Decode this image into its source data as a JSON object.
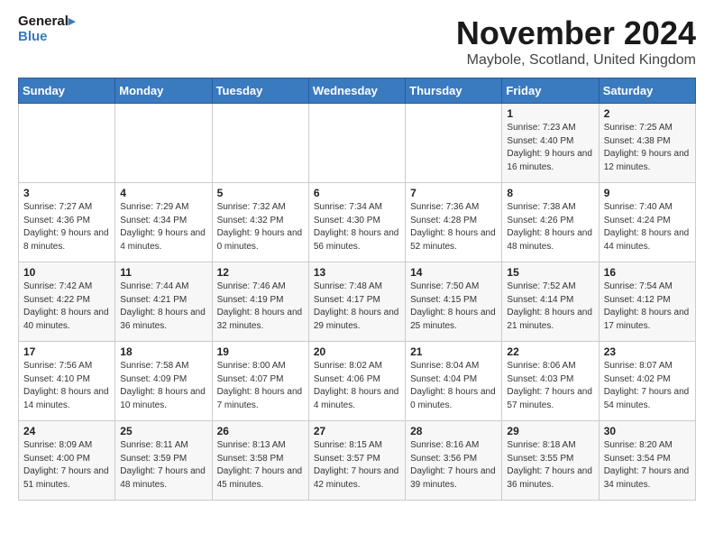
{
  "logo": {
    "line1": "General",
    "line2": "Blue"
  },
  "title": "November 2024",
  "location": "Maybole, Scotland, United Kingdom",
  "days_of_week": [
    "Sunday",
    "Monday",
    "Tuesday",
    "Wednesday",
    "Thursday",
    "Friday",
    "Saturday"
  ],
  "weeks": [
    [
      {
        "day": "",
        "info": ""
      },
      {
        "day": "",
        "info": ""
      },
      {
        "day": "",
        "info": ""
      },
      {
        "day": "",
        "info": ""
      },
      {
        "day": "",
        "info": ""
      },
      {
        "day": "1",
        "info": "Sunrise: 7:23 AM\nSunset: 4:40 PM\nDaylight: 9 hours and 16 minutes."
      },
      {
        "day": "2",
        "info": "Sunrise: 7:25 AM\nSunset: 4:38 PM\nDaylight: 9 hours and 12 minutes."
      }
    ],
    [
      {
        "day": "3",
        "info": "Sunrise: 7:27 AM\nSunset: 4:36 PM\nDaylight: 9 hours and 8 minutes."
      },
      {
        "day": "4",
        "info": "Sunrise: 7:29 AM\nSunset: 4:34 PM\nDaylight: 9 hours and 4 minutes."
      },
      {
        "day": "5",
        "info": "Sunrise: 7:32 AM\nSunset: 4:32 PM\nDaylight: 9 hours and 0 minutes."
      },
      {
        "day": "6",
        "info": "Sunrise: 7:34 AM\nSunset: 4:30 PM\nDaylight: 8 hours and 56 minutes."
      },
      {
        "day": "7",
        "info": "Sunrise: 7:36 AM\nSunset: 4:28 PM\nDaylight: 8 hours and 52 minutes."
      },
      {
        "day": "8",
        "info": "Sunrise: 7:38 AM\nSunset: 4:26 PM\nDaylight: 8 hours and 48 minutes."
      },
      {
        "day": "9",
        "info": "Sunrise: 7:40 AM\nSunset: 4:24 PM\nDaylight: 8 hours and 44 minutes."
      }
    ],
    [
      {
        "day": "10",
        "info": "Sunrise: 7:42 AM\nSunset: 4:22 PM\nDaylight: 8 hours and 40 minutes."
      },
      {
        "day": "11",
        "info": "Sunrise: 7:44 AM\nSunset: 4:21 PM\nDaylight: 8 hours and 36 minutes."
      },
      {
        "day": "12",
        "info": "Sunrise: 7:46 AM\nSunset: 4:19 PM\nDaylight: 8 hours and 32 minutes."
      },
      {
        "day": "13",
        "info": "Sunrise: 7:48 AM\nSunset: 4:17 PM\nDaylight: 8 hours and 29 minutes."
      },
      {
        "day": "14",
        "info": "Sunrise: 7:50 AM\nSunset: 4:15 PM\nDaylight: 8 hours and 25 minutes."
      },
      {
        "day": "15",
        "info": "Sunrise: 7:52 AM\nSunset: 4:14 PM\nDaylight: 8 hours and 21 minutes."
      },
      {
        "day": "16",
        "info": "Sunrise: 7:54 AM\nSunset: 4:12 PM\nDaylight: 8 hours and 17 minutes."
      }
    ],
    [
      {
        "day": "17",
        "info": "Sunrise: 7:56 AM\nSunset: 4:10 PM\nDaylight: 8 hours and 14 minutes."
      },
      {
        "day": "18",
        "info": "Sunrise: 7:58 AM\nSunset: 4:09 PM\nDaylight: 8 hours and 10 minutes."
      },
      {
        "day": "19",
        "info": "Sunrise: 8:00 AM\nSunset: 4:07 PM\nDaylight: 8 hours and 7 minutes."
      },
      {
        "day": "20",
        "info": "Sunrise: 8:02 AM\nSunset: 4:06 PM\nDaylight: 8 hours and 4 minutes."
      },
      {
        "day": "21",
        "info": "Sunrise: 8:04 AM\nSunset: 4:04 PM\nDaylight: 8 hours and 0 minutes."
      },
      {
        "day": "22",
        "info": "Sunrise: 8:06 AM\nSunset: 4:03 PM\nDaylight: 7 hours and 57 minutes."
      },
      {
        "day": "23",
        "info": "Sunrise: 8:07 AM\nSunset: 4:02 PM\nDaylight: 7 hours and 54 minutes."
      }
    ],
    [
      {
        "day": "24",
        "info": "Sunrise: 8:09 AM\nSunset: 4:00 PM\nDaylight: 7 hours and 51 minutes."
      },
      {
        "day": "25",
        "info": "Sunrise: 8:11 AM\nSunset: 3:59 PM\nDaylight: 7 hours and 48 minutes."
      },
      {
        "day": "26",
        "info": "Sunrise: 8:13 AM\nSunset: 3:58 PM\nDaylight: 7 hours and 45 minutes."
      },
      {
        "day": "27",
        "info": "Sunrise: 8:15 AM\nSunset: 3:57 PM\nDaylight: 7 hours and 42 minutes."
      },
      {
        "day": "28",
        "info": "Sunrise: 8:16 AM\nSunset: 3:56 PM\nDaylight: 7 hours and 39 minutes."
      },
      {
        "day": "29",
        "info": "Sunrise: 8:18 AM\nSunset: 3:55 PM\nDaylight: 7 hours and 36 minutes."
      },
      {
        "day": "30",
        "info": "Sunrise: 8:20 AM\nSunset: 3:54 PM\nDaylight: 7 hours and 34 minutes."
      }
    ]
  ]
}
